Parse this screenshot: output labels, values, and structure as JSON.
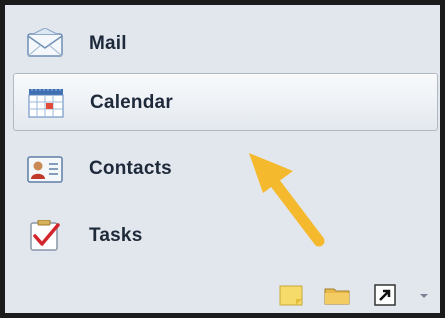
{
  "nav": {
    "items": [
      {
        "label": "Mail",
        "icon": "mail-icon",
        "selected": false
      },
      {
        "label": "Calendar",
        "icon": "calendar-icon",
        "selected": true
      },
      {
        "label": "Contacts",
        "icon": "contacts-icon",
        "selected": false
      },
      {
        "label": "Tasks",
        "icon": "tasks-icon",
        "selected": false
      }
    ]
  },
  "bottom_bar": {
    "icons": [
      "notes-icon",
      "folder-icon",
      "shortcut-icon",
      "configure-buttons-chevron-icon"
    ]
  },
  "annotation": {
    "arrow_color": "#f5b92e"
  },
  "colors": {
    "frame": "#1b1b1b",
    "pane_background": "#e2e7ee",
    "selected_background": "#eef2f6",
    "label_text": "#1e2a3a"
  }
}
